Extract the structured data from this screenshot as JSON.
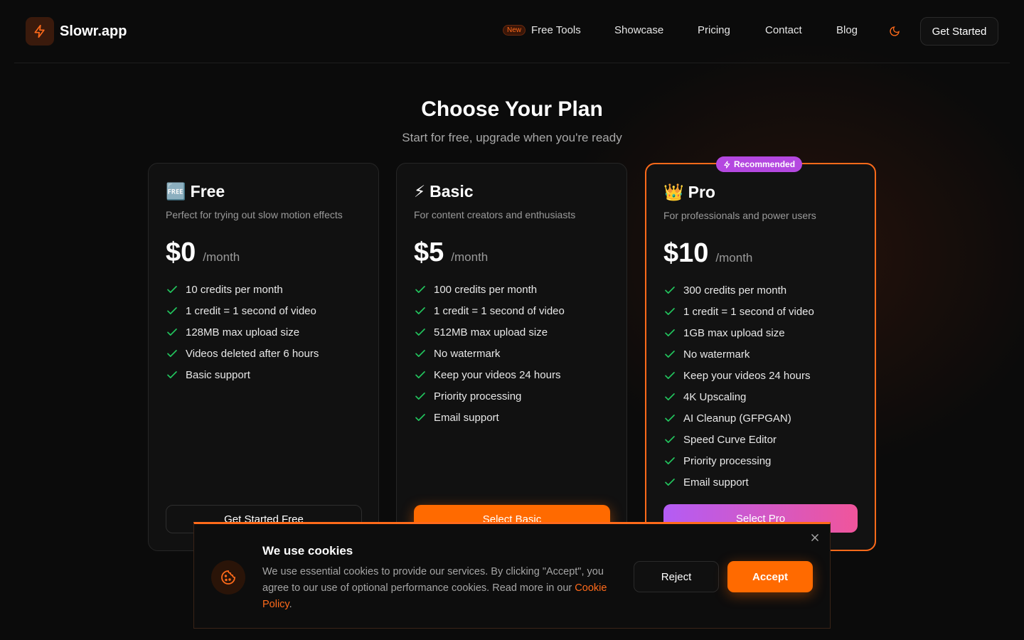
{
  "header": {
    "brand": "Slowr.app",
    "nav": [
      {
        "label": "Free Tools",
        "badge": "New"
      },
      {
        "label": "Showcase"
      },
      {
        "label": "Pricing"
      },
      {
        "label": "Contact"
      },
      {
        "label": "Blog"
      }
    ],
    "cta": "Get Started",
    "icons": {
      "logo": "bolt-icon",
      "theme": "moon-icon"
    }
  },
  "hero": {
    "title": "Choose Your Plan",
    "subtitle": "Start for free, upgrade when you're ready"
  },
  "plans": [
    {
      "emoji": "🆓",
      "name": "Free",
      "description": "Perfect for trying out slow motion effects",
      "price": "$0",
      "period": "/month",
      "features": [
        "10 credits per month",
        "1 credit = 1 second of video",
        "128MB max upload size",
        "Videos deleted after 6 hours",
        "Basic support"
      ],
      "button": "Get Started Free"
    },
    {
      "emoji": "⚡",
      "name": "Basic",
      "description": "For content creators and enthusiasts",
      "price": "$5",
      "period": "/month",
      "features": [
        "100 credits per month",
        "1 credit = 1 second of video",
        "512MB max upload size",
        "No watermark",
        "Keep your videos 24 hours",
        "Priority processing",
        "Email support"
      ],
      "button": "Select Basic"
    },
    {
      "emoji": "👑",
      "name": "Pro",
      "badge": "Recommended",
      "description": "For professionals and power users",
      "price": "$10",
      "period": "/month",
      "features": [
        "300 credits per month",
        "1 credit = 1 second of video",
        "1GB max upload size",
        "No watermark",
        "Keep your videos 24 hours",
        "4K Upscaling",
        "AI Cleanup (GFPGAN)",
        "Speed Curve Editor",
        "Priority processing",
        "Email support"
      ],
      "button": "Select Pro"
    }
  ],
  "cookie": {
    "title": "We use cookies",
    "text": "We use essential cookies to provide our services. By clicking \"Accept\", you agree to our use of optional performance cookies. Read more in our ",
    "link": "Cookie Policy",
    "suffix": ".",
    "reject": "Reject",
    "accept": "Accept"
  },
  "colors": {
    "accent": "#ff6a00",
    "pro_gradient_start": "#b35cf5",
    "pro_gradient_end": "#f0559b",
    "check": "#22c55e"
  }
}
